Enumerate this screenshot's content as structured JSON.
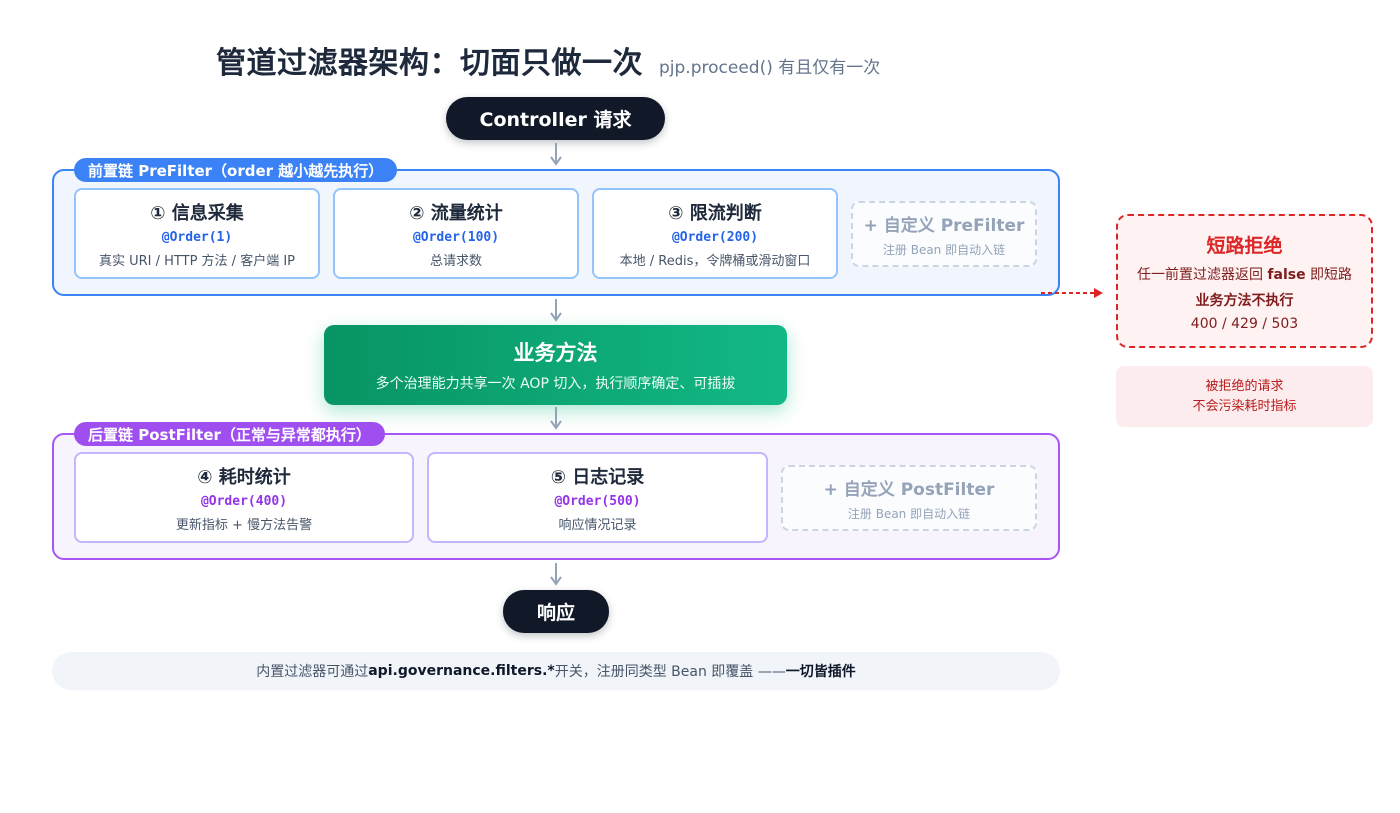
{
  "title": {
    "main": "管道过滤器架构：切面只做一次",
    "sub": "pjp.proceed() 有且仅有一次"
  },
  "controller_label": "Controller 请求",
  "pre_chain": {
    "label": "前置链 PreFilter（order 越小越先执行）",
    "cards": [
      {
        "title": "① 信息采集",
        "order": "@Order(1)",
        "desc": "真实 URI / HTTP 方法 / 客户端 IP"
      },
      {
        "title": "② 流量统计",
        "order": "@Order(100)",
        "desc": "总请求数"
      },
      {
        "title": "③ 限流判断",
        "order": "@Order(200)",
        "desc": "本地 / Redis，令牌桶或滑动窗口"
      }
    ],
    "add": {
      "title": "+ 自定义 PreFilter",
      "sub": "注册 Bean 即自动入链"
    }
  },
  "business": {
    "title": "业务方法",
    "desc": "多个治理能力共享一次 AOP 切入，执行顺序确定、可插拔"
  },
  "post_chain": {
    "label": "后置链 PostFilter（正常与异常都执行）",
    "cards": [
      {
        "title": "④ 耗时统计",
        "order": "@Order(400)",
        "desc": "更新指标 + 慢方法告警"
      },
      {
        "title": "⑤ 日志记录",
        "order": "@Order(500)",
        "desc": "响应情况记录"
      }
    ],
    "add": {
      "title": "+ 自定义 PostFilter",
      "sub": "注册 Bean 即自动入链"
    }
  },
  "response_label": "响应",
  "short_circuit": {
    "title": "短路拒绝",
    "line1_pre": "任一前置过滤器返回 ",
    "line1_bold": "false",
    "line1_post": " 即短路",
    "line2": "业务方法不执行",
    "line3": "400 / 429 / 503",
    "note_line1": "被拒绝的请求",
    "note_line2": "不会污染耗时指标"
  },
  "footer": {
    "pre": "内置过滤器可通过 ",
    "bold1": "api.governance.filters.*",
    "mid": " 开关，注册同类型 Bean 即覆盖 —— ",
    "bold2": "一切皆插件"
  },
  "colors": {
    "pre_border": "#3b82f6",
    "post_border": "#a855f7",
    "business_green": "#10b981",
    "reject_red": "#dc2626",
    "dark_pill": "#111827"
  }
}
